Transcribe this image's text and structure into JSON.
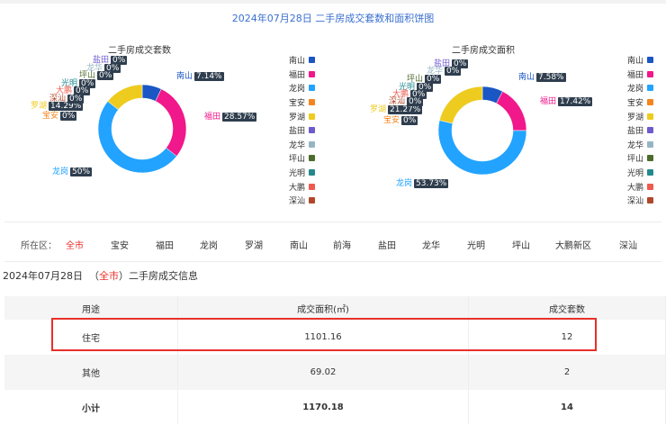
{
  "header": {
    "title": "2024年07月28日 二手房成交套数和面积饼图"
  },
  "colors": {
    "南山": "#1a56c4",
    "福田": "#f0188a",
    "龙岗": "#22a3ff",
    "宝安": "#f5841f",
    "罗湖": "#eecb1f",
    "盐田": "#6f5acd",
    "龙华": "#96b5c3",
    "坪山": "#4d6b2d",
    "光明": "#24898f",
    "大鹏": "#ef5a4e",
    "深汕": "#b0472a"
  },
  "legend": [
    "南山",
    "福田",
    "龙岗",
    "宝安",
    "罗湖",
    "盐田",
    "龙华",
    "坪山",
    "光明",
    "大鹏",
    "深汕"
  ],
  "chart_data": [
    {
      "type": "pie",
      "title": "二手房成交套数",
      "categories": [
        "南山",
        "福田",
        "龙岗",
        "宝安",
        "罗湖",
        "盐田",
        "龙华",
        "坪山",
        "光明",
        "大鹏",
        "深汕"
      ],
      "values": [
        7.14,
        28.57,
        50,
        0,
        14.29,
        0,
        0,
        0,
        0,
        0,
        0
      ],
      "labels": [
        "7.14%",
        "28.57%",
        "50%",
        "0%",
        "14.29%",
        "0%",
        "0%",
        "0%",
        "0%",
        "0%",
        "0%"
      ]
    },
    {
      "type": "pie",
      "title": "二手房成交面积",
      "categories": [
        "南山",
        "福田",
        "龙岗",
        "宝安",
        "罗湖",
        "盐田",
        "龙华",
        "坪山",
        "光明",
        "大鹏",
        "深汕"
      ],
      "values": [
        7.58,
        17.42,
        53.73,
        0,
        21.27,
        0,
        0,
        0,
        0,
        0,
        0
      ],
      "labels": [
        "7.58%",
        "17.42%",
        "53.73%",
        "0%",
        "21.27%",
        "0%",
        "0%",
        "0%",
        "0%",
        "0%",
        "0%"
      ]
    }
  ],
  "filter": {
    "label": "所在区：",
    "items": [
      "全市",
      "宝安",
      "福田",
      "龙岗",
      "罗湖",
      "南山",
      "前海",
      "盐田",
      "龙华",
      "光明",
      "坪山",
      "大鹏新区",
      "深汕"
    ]
  },
  "info": {
    "date": "2024年07月28日",
    "open": "（",
    "region": "全市",
    "close": "）二手房成交信息"
  },
  "table": {
    "headers": [
      "用途",
      "成交面积(㎡)",
      "成交套数"
    ],
    "rows": [
      [
        "住宅",
        "1101.16",
        "12"
      ],
      [
        "其他",
        "69.02",
        "2"
      ],
      [
        "小计",
        "1170.18",
        "14"
      ]
    ]
  }
}
